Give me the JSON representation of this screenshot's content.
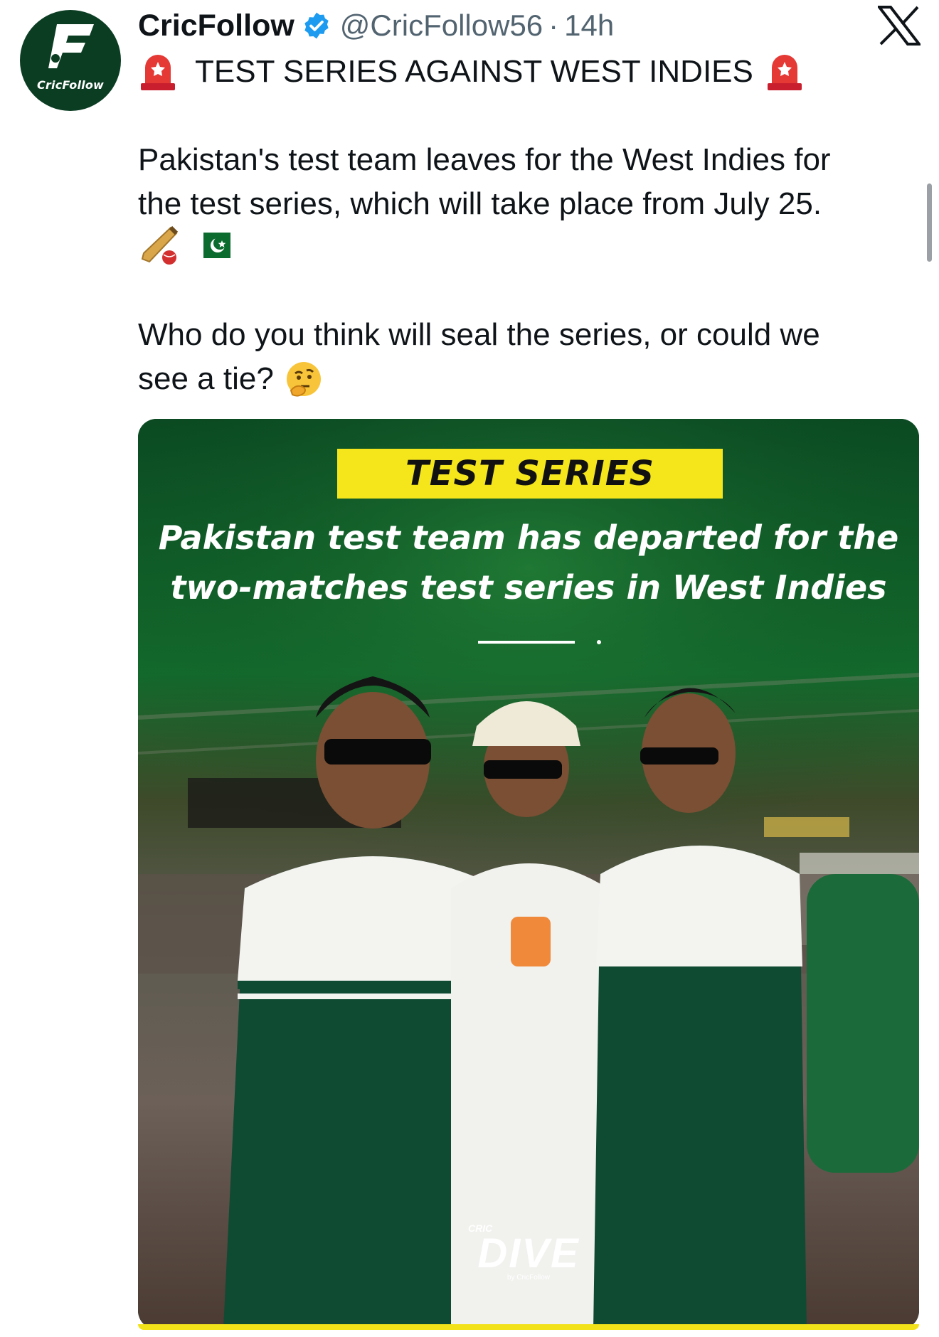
{
  "tweet": {
    "author_name": "CricFollow",
    "handle": "@CricFollow56",
    "separator": "·",
    "age": "14h",
    "avatar_text": "CricFollow",
    "title_line": "TEST SERIES AGAINST WEST INDIES",
    "body_line1": "Pakistan's test team leaves for the West Indies for",
    "body_line2": "the test series, which will take place from July 25.",
    "question_line1": "Who do you think will seal the series, or could we",
    "question_line2": "see a tie?",
    "icons": [
      "siren-icon",
      "cricket-bat-icon",
      "pakistan-flag-icon",
      "thinking-face-icon",
      "verified-badge-icon",
      "x-logo-icon"
    ]
  },
  "card": {
    "banner": "TEST SERIES",
    "subtitle_line1": "Pakistan test team has departed for the",
    "subtitle_line2": "two-matches test series in West Indies",
    "brand_small": "CRIC",
    "brand_big": "DIVE",
    "brand_by": "by CricFollow",
    "colors": {
      "green": "#0d4a24",
      "yellow": "#f5e61c"
    }
  }
}
